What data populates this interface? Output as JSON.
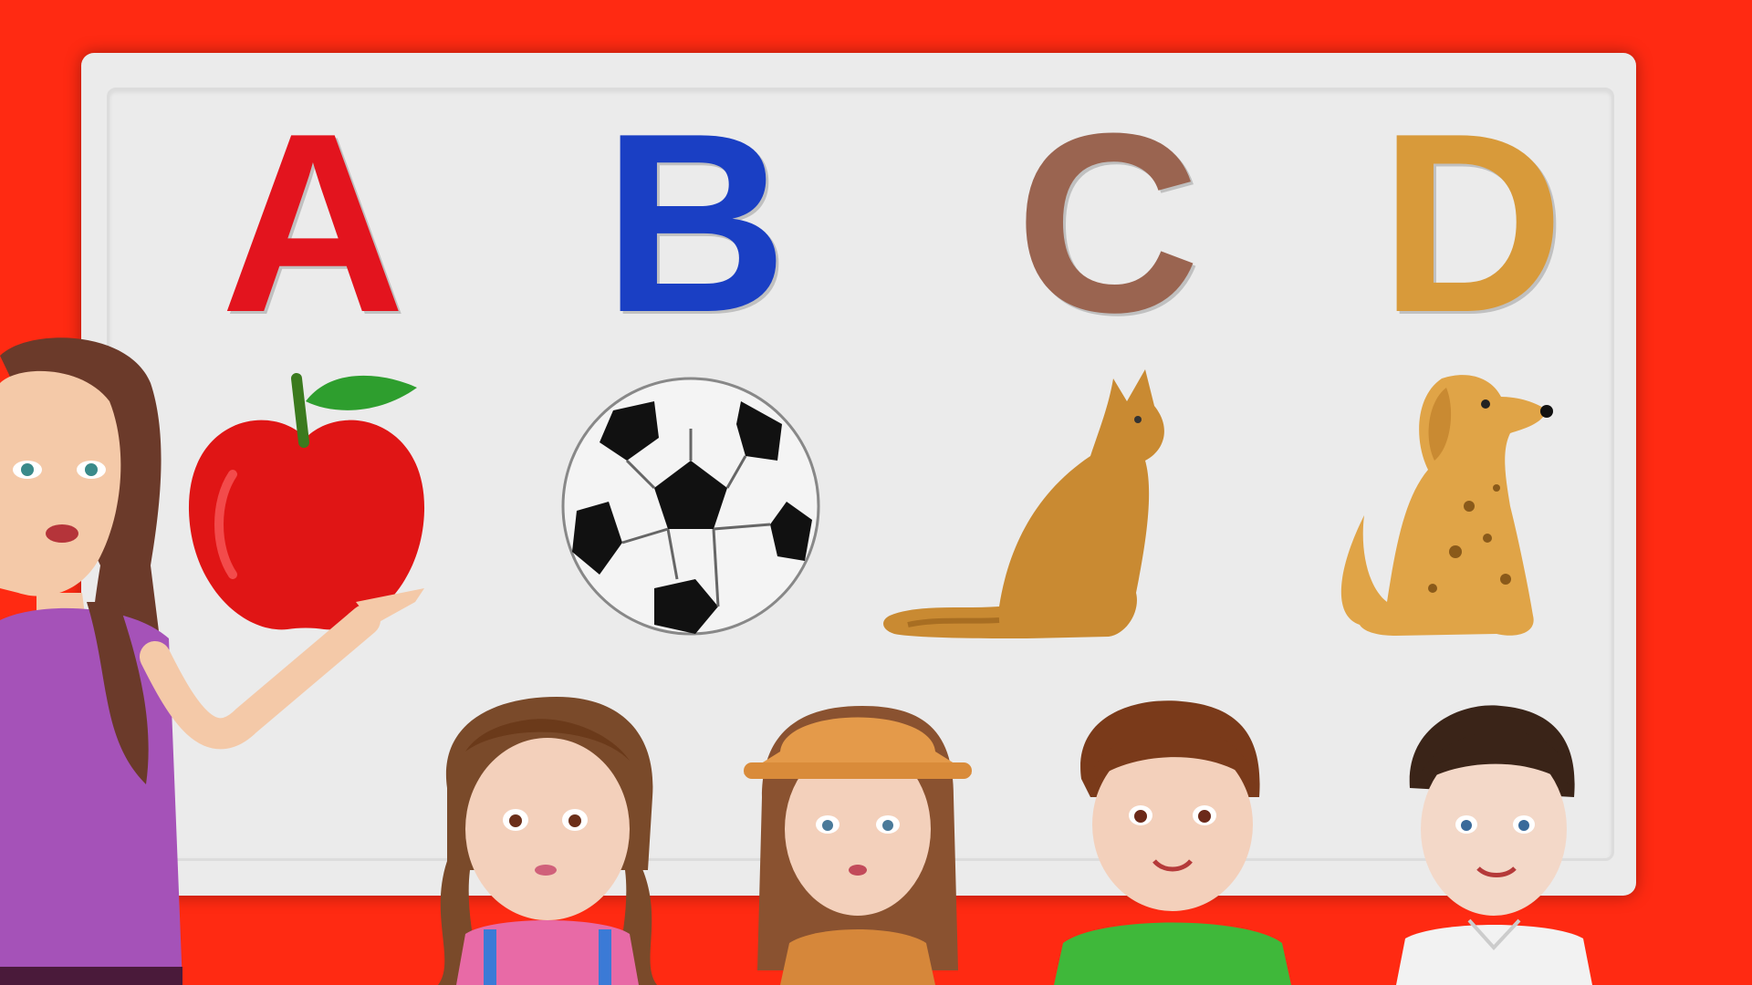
{
  "letters": [
    {
      "char": "A",
      "color": "#e3141e"
    },
    {
      "char": "B",
      "color": "#1a3fc4"
    },
    {
      "char": "C",
      "color": "#9a6450"
    },
    {
      "char": "D",
      "color": "#d89a3a"
    }
  ],
  "pictures": [
    "apple-icon",
    "soccer-ball-icon",
    "cat-icon",
    "dog-icon"
  ],
  "colors": {
    "background": "#ff2a12",
    "board": "#ebebeb"
  }
}
